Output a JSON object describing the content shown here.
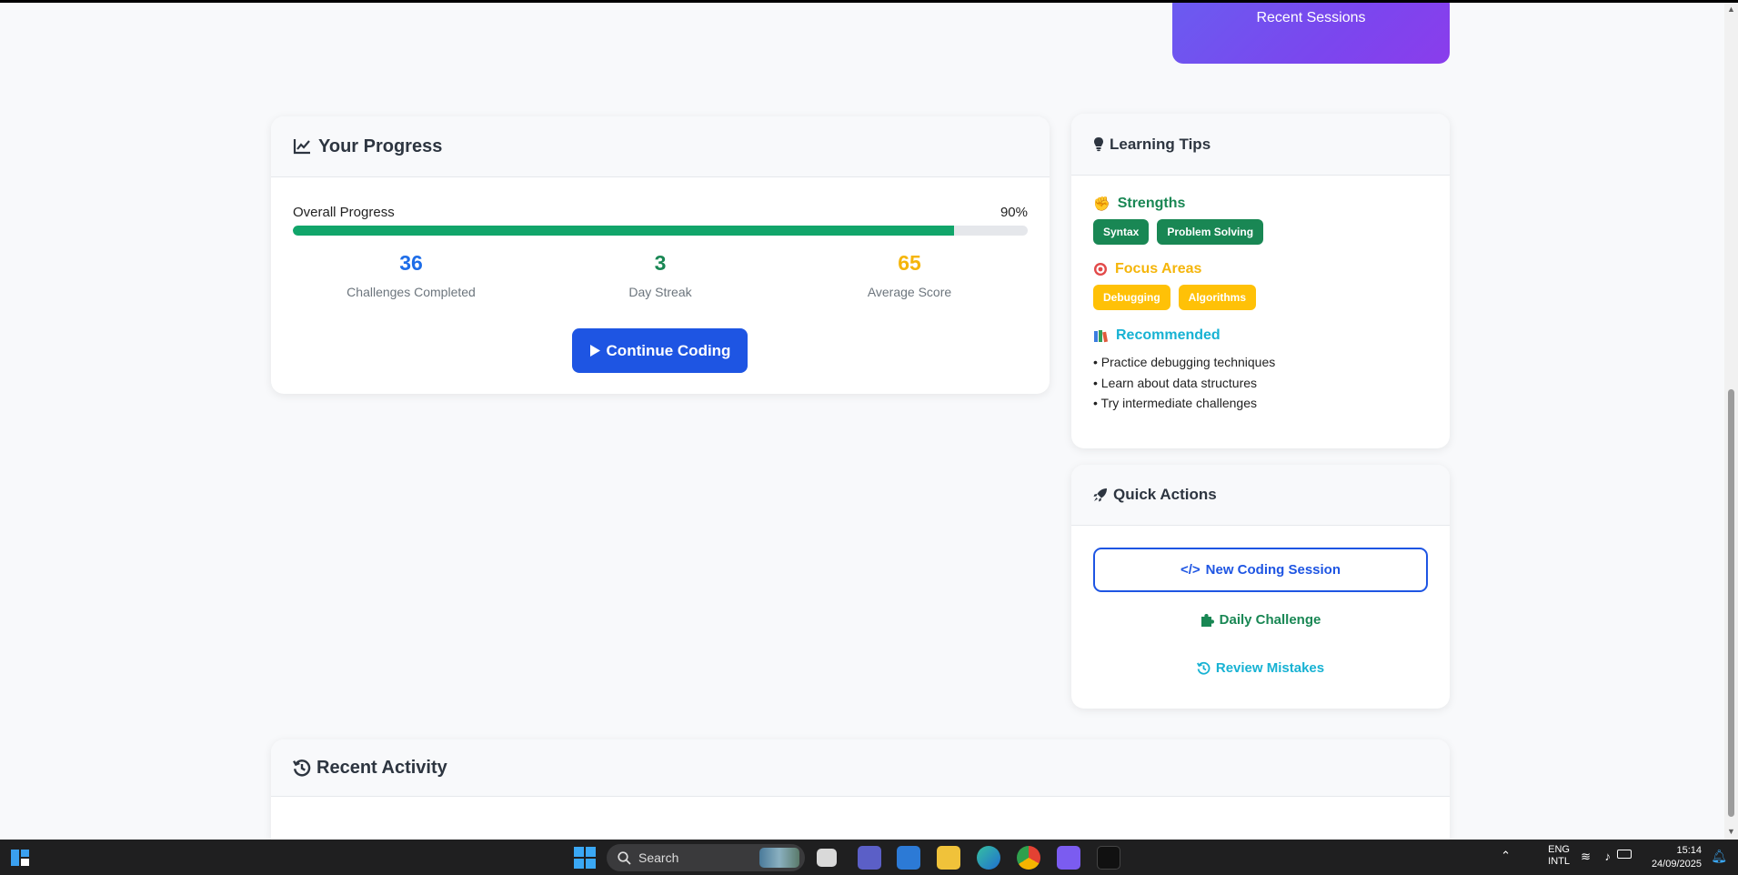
{
  "recent_sessions": {
    "label": "Recent Sessions"
  },
  "progress": {
    "title": "Your Progress",
    "overall_label": "Overall Progress",
    "overall_percent_text": "90%",
    "overall_fraction": 0.9,
    "stats": [
      {
        "value": "36",
        "label": "Challenges Completed",
        "color": "#1e6de8"
      },
      {
        "value": "3",
        "label": "Day Streak",
        "color": "#198754"
      },
      {
        "value": "65",
        "label": "Average Score",
        "color": "#f5b50a"
      }
    ],
    "continue_label": "Continue Coding"
  },
  "tips": {
    "title": "Learning Tips",
    "strengths": {
      "title": "Strengths",
      "tags": [
        "Syntax",
        "Problem Solving"
      ]
    },
    "focus": {
      "title": "Focus Areas",
      "tags": [
        "Debugging",
        "Algorithms"
      ]
    },
    "recommended": {
      "title": "Recommended",
      "items": [
        "• Practice debugging techniques",
        "• Learn about data structures",
        "• Try intermediate challenges"
      ]
    }
  },
  "quick_actions": {
    "title": "Quick Actions",
    "new_session": "New Coding Session",
    "daily_challenge": "Daily Challenge",
    "review_mistakes": "Review Mistakes"
  },
  "activity": {
    "title": "Recent Activity"
  },
  "taskbar": {
    "search_label": "Search",
    "lang_top": "ENG",
    "lang_bottom": "INTL",
    "time": "15:14",
    "date": "24/09/2025"
  },
  "colors": {
    "primary": "#1e55e3",
    "success": "#198754",
    "warning": "#ffc107",
    "info": "#17b2d3",
    "progress_fill": "#11a56a"
  }
}
